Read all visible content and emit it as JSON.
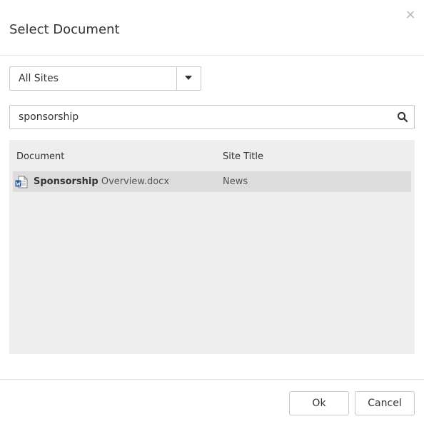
{
  "dialog": {
    "title": "Select Document",
    "close_glyph": "×"
  },
  "site_filter": {
    "selected": "All Sites",
    "caret_icon": "caret-down-icon"
  },
  "search": {
    "value": "sponsorship",
    "icon": "search-icon"
  },
  "results": {
    "columns": [
      "Document",
      "Site Title"
    ],
    "rows": [
      {
        "icon": "word-document-icon",
        "name_match": "Sponsorship",
        "name_rest": " Overview.docx",
        "site": "News"
      }
    ]
  },
  "footer": {
    "ok_label": "Ok",
    "cancel_label": "Cancel"
  },
  "colors": {
    "border": "#c8c8c8",
    "panel_bg": "#eeeeee",
    "selected_row": "#dcdcdc",
    "word_blue": "#2b579a"
  }
}
